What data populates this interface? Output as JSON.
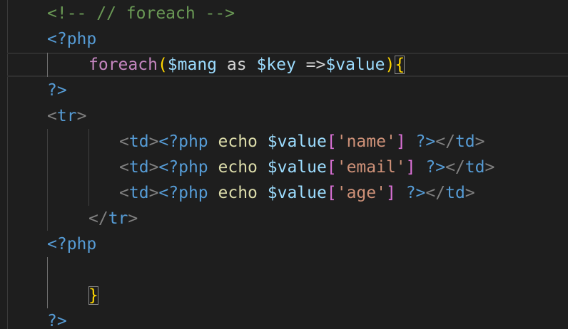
{
  "editor": {
    "lines": [
      {
        "indent": 1,
        "tokens": [
          {
            "text": "<!-- // foreach -->",
            "cls": "c-comment"
          }
        ]
      },
      {
        "indent": 1,
        "tokens": [
          {
            "text": "<?php",
            "cls": "c-tag"
          }
        ]
      },
      {
        "indent": 2,
        "tokens": [
          {
            "text": "foreach",
            "cls": "c-keyword"
          },
          {
            "text": "(",
            "cls": "c-paren"
          },
          {
            "text": "$mang",
            "cls": "c-var"
          },
          {
            "text": " as ",
            "cls": "c-plain"
          },
          {
            "text": "$key",
            "cls": "c-var"
          },
          {
            "text": " =>",
            "cls": "c-plain"
          },
          {
            "text": "$value",
            "cls": "c-var"
          },
          {
            "text": ")",
            "cls": "c-paren"
          },
          {
            "text": "{",
            "cls": "c-paren",
            "cursor": true
          }
        ]
      },
      {
        "indent": 1,
        "tokens": [
          {
            "text": "?>",
            "cls": "c-tag"
          }
        ]
      },
      {
        "indent": 1,
        "tokens": [
          {
            "text": "<",
            "cls": "c-bracket"
          },
          {
            "text": "tr",
            "cls": "c-tag"
          },
          {
            "text": ">",
            "cls": "c-bracket"
          }
        ]
      },
      {
        "indent": 3,
        "tokens": [
          {
            "text": "<",
            "cls": "c-bracket"
          },
          {
            "text": "td",
            "cls": "c-tag"
          },
          {
            "text": ">",
            "cls": "c-bracket"
          },
          {
            "text": "<?php",
            "cls": "c-tag"
          },
          {
            "text": " echo ",
            "cls": "c-func"
          },
          {
            "text": "$value",
            "cls": "c-var"
          },
          {
            "text": "[",
            "cls": "c-sqbr"
          },
          {
            "text": "'name'",
            "cls": "c-string"
          },
          {
            "text": "]",
            "cls": "c-sqbr"
          },
          {
            "text": " ",
            "cls": "c-plain"
          },
          {
            "text": "?>",
            "cls": "c-tag"
          },
          {
            "text": "</",
            "cls": "c-bracket"
          },
          {
            "text": "td",
            "cls": "c-tag"
          },
          {
            "text": ">",
            "cls": "c-bracket"
          }
        ]
      },
      {
        "indent": 3,
        "tokens": [
          {
            "text": "<",
            "cls": "c-bracket"
          },
          {
            "text": "td",
            "cls": "c-tag"
          },
          {
            "text": ">",
            "cls": "c-bracket"
          },
          {
            "text": "<?php",
            "cls": "c-tag"
          },
          {
            "text": " echo ",
            "cls": "c-func"
          },
          {
            "text": "$value",
            "cls": "c-var"
          },
          {
            "text": "[",
            "cls": "c-sqbr"
          },
          {
            "text": "'email'",
            "cls": "c-string"
          },
          {
            "text": "]",
            "cls": "c-sqbr"
          },
          {
            "text": " ",
            "cls": "c-plain"
          },
          {
            "text": "?>",
            "cls": "c-tag"
          },
          {
            "text": "</",
            "cls": "c-bracket"
          },
          {
            "text": "td",
            "cls": "c-tag"
          },
          {
            "text": ">",
            "cls": "c-bracket"
          }
        ]
      },
      {
        "indent": 3,
        "tokens": [
          {
            "text": "<",
            "cls": "c-bracket"
          },
          {
            "text": "td",
            "cls": "c-tag"
          },
          {
            "text": ">",
            "cls": "c-bracket"
          },
          {
            "text": "<?php",
            "cls": "c-tag"
          },
          {
            "text": " echo ",
            "cls": "c-func"
          },
          {
            "text": "$value",
            "cls": "c-var"
          },
          {
            "text": "[",
            "cls": "c-sqbr"
          },
          {
            "text": "'age'",
            "cls": "c-string"
          },
          {
            "text": "]",
            "cls": "c-sqbr"
          },
          {
            "text": " ",
            "cls": "c-plain"
          },
          {
            "text": "?>",
            "cls": "c-tag"
          },
          {
            "text": "</",
            "cls": "c-bracket"
          },
          {
            "text": "td",
            "cls": "c-tag"
          },
          {
            "text": ">",
            "cls": "c-bracket"
          }
        ]
      },
      {
        "indent": 2,
        "tokens": [
          {
            "text": "</",
            "cls": "c-bracket"
          },
          {
            "text": "tr",
            "cls": "c-tag"
          },
          {
            "text": ">",
            "cls": "c-bracket"
          }
        ]
      },
      {
        "indent": 1,
        "tokens": [
          {
            "text": "<?php",
            "cls": "c-tag"
          }
        ]
      },
      {
        "indent": 1,
        "tokens": []
      },
      {
        "indent": 2,
        "tokens": [
          {
            "text": "}",
            "cls": "c-paren",
            "cursor": true
          }
        ]
      },
      {
        "indent": 1,
        "tokens": [
          {
            "text": "?>",
            "cls": "c-tag"
          }
        ]
      }
    ]
  },
  "colors": {
    "background": "#1e1e1e",
    "comment": "#6a9955",
    "tag": "#569cd6",
    "bracket": "#808080",
    "keyword": "#c586c0",
    "variable": "#9cdcfe",
    "function": "#dcdcaa",
    "string": "#ce9178",
    "brace": "#ffd700",
    "square_bracket": "#da70d6"
  }
}
